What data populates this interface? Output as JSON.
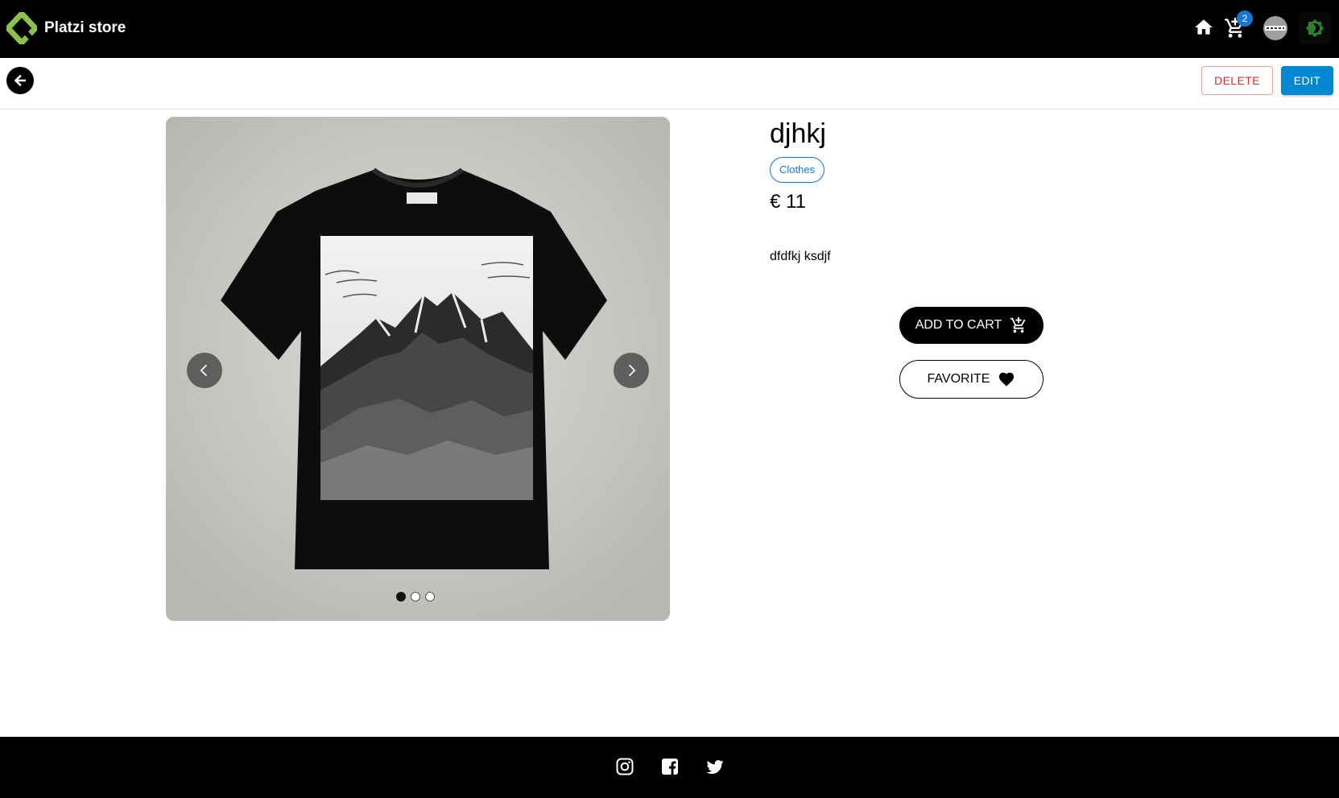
{
  "header": {
    "brand": "Platzi store",
    "cart_count": "2",
    "icons": [
      "logo-icon",
      "home-icon",
      "cart-icon",
      "avatar",
      "theme-toggle-icon"
    ],
    "colors": {
      "background": "#000000",
      "logo": "#8bc34a",
      "badge": "#1976d2",
      "theme_icon": "#2e7d32"
    }
  },
  "actions": {
    "delete_label": "DELETE",
    "edit_label": "EDIT",
    "colors": {
      "delete": "#d32f2f",
      "edit": "#0288d1"
    }
  },
  "product": {
    "title": "djhkj",
    "category": "Clothes",
    "price": "€ 11",
    "description": "dfdfkj ksdjf",
    "image_alt": "black t-shirt with mountain print",
    "carousel": {
      "slides": 3,
      "active_index": 0
    }
  },
  "buttons": {
    "add_to_cart": "ADD TO CART",
    "favorite": "FAVORITE"
  },
  "footer": {
    "social": [
      "instagram-icon",
      "facebook-icon",
      "twitter-icon"
    ]
  }
}
